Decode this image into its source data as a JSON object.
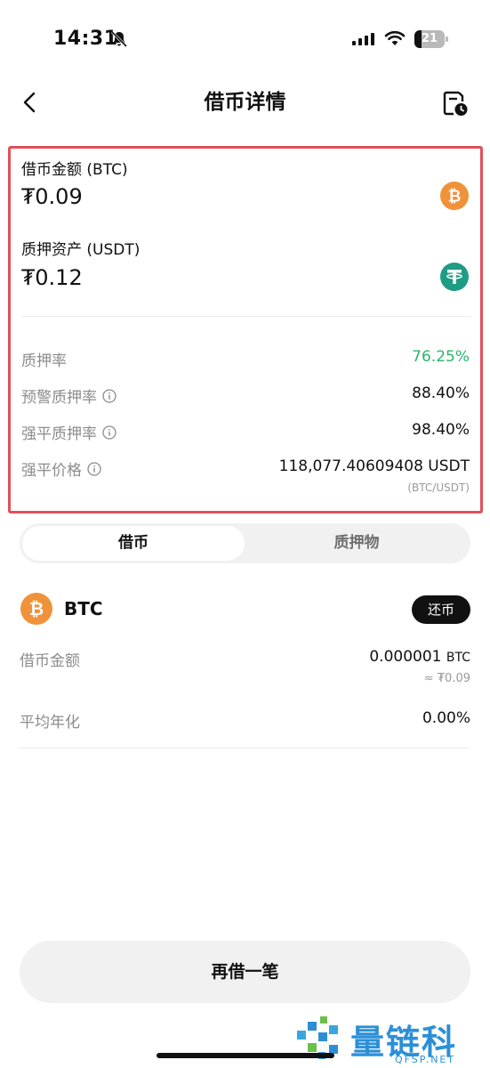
{
  "status_bar": {
    "time": "14:31",
    "battery": "21"
  },
  "nav": {
    "title": "借币详情"
  },
  "summary": {
    "borrow_label": "借币金额 (BTC)",
    "borrow_value": "₮0.09",
    "collateral_label": "质押资产 (USDT)",
    "collateral_value": "₮0.12",
    "metrics": {
      "ltv_label": "质押率",
      "ltv_value": "76.25%",
      "warning_label": "预警质押率",
      "warning_value": "88.40%",
      "liquidation_ltv_label": "强平质押率",
      "liquidation_ltv_value": "98.40%",
      "liquidation_price_label": "强平价格",
      "liquidation_price_value": "118,077.40609408 USDT",
      "liquidation_price_pair": "(BTC/USDT)"
    }
  },
  "tabs": [
    {
      "label": "借币",
      "active": true
    },
    {
      "label": "质押物",
      "active": false
    }
  ],
  "loan": {
    "asset": "BTC",
    "repay_label": "还币",
    "amount_label": "借币金额",
    "amount_value": "0.000001",
    "amount_unit": "BTC",
    "amount_approx": "≈ ₮0.09",
    "apr_label": "平均年化",
    "apr_value": "0.00%"
  },
  "actions": {
    "borrow_again": "再借一笔"
  },
  "watermark": {
    "text": "量链科技",
    "sub": "QFSP.NET"
  },
  "colors": {
    "highlight_border": "#e0505a",
    "positive": "#2bb56b",
    "btc_orange": "#f0923a",
    "usdt_teal": "#1f9c84"
  }
}
